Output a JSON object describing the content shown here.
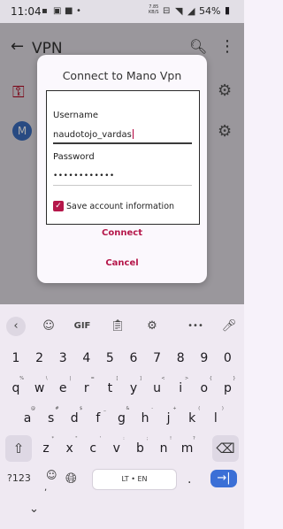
{
  "status_bar": {
    "time": "11:04",
    "net_speed_value": "7.85",
    "net_speed_unit": "KB/S",
    "net_type": "4G",
    "battery": "54%"
  },
  "app_bar": {
    "title": "VPN"
  },
  "vpn_logo_text": "M",
  "dialog": {
    "title": "Connect to Mano Vpn",
    "username_label": "Username",
    "username_value": "naudotojo_vardas",
    "password_label": "Password",
    "password_mask": "••••••••••••",
    "save_checkbox_checked": true,
    "save_label": "Save account information",
    "connect_label": "Connect",
    "cancel_label": "Cancel"
  },
  "keyboard": {
    "toolbar": {
      "gif_label": "GIF",
      "more_label": "•••"
    },
    "rows": [
      [
        {
          "k": "1"
        },
        {
          "k": "2"
        },
        {
          "k": "3"
        },
        {
          "k": "4"
        },
        {
          "k": "5"
        },
        {
          "k": "6"
        },
        {
          "k": "7"
        },
        {
          "k": "8"
        },
        {
          "k": "9"
        },
        {
          "k": "0"
        }
      ],
      [
        {
          "k": "q",
          "a": "%"
        },
        {
          "k": "w",
          "a": "\\"
        },
        {
          "k": "e",
          "a": "|"
        },
        {
          "k": "r",
          "a": "="
        },
        {
          "k": "t",
          "a": "["
        },
        {
          "k": "y",
          "a": "]"
        },
        {
          "k": "u",
          "a": "<"
        },
        {
          "k": "i",
          "a": ">"
        },
        {
          "k": "o",
          "a": "{"
        },
        {
          "k": "p",
          "a": "}"
        }
      ],
      [
        {
          "k": "a",
          "a": "@"
        },
        {
          "k": "s",
          "a": "#"
        },
        {
          "k": "d",
          "a": "$"
        },
        {
          "k": "f",
          "a": "_"
        },
        {
          "k": "g",
          "a": "&"
        },
        {
          "k": "h",
          "a": "-"
        },
        {
          "k": "j",
          "a": "+"
        },
        {
          "k": "k",
          "a": "("
        },
        {
          "k": "l",
          "a": ")"
        }
      ],
      [
        {
          "k": "z",
          "a": "*"
        },
        {
          "k": "x",
          "a": "\""
        },
        {
          "k": "c",
          "a": "'"
        },
        {
          "k": "v",
          "a": ":"
        },
        {
          "k": "b",
          "a": ";"
        },
        {
          "k": "n",
          "a": "!"
        },
        {
          "k": "m",
          "a": "?"
        }
      ]
    ],
    "symbols_label": "?123",
    "comma_label": ",",
    "space_label": "LT • EN",
    "period_label": ".",
    "enter_label": "→|"
  },
  "colors": {
    "accent": "#b5174a",
    "enter_key": "#3b6fd6"
  },
  "icons": [
    "back-arrow-icon",
    "search-icon",
    "more-vert-icon",
    "key-icon",
    "gear-icon",
    "sticker-icon",
    "clipboard-icon",
    "settings-icon",
    "mic-icon",
    "shift-icon",
    "backspace-icon",
    "emoji-icon",
    "globe-icon",
    "enter-icon",
    "hide-keyboard-icon"
  ]
}
